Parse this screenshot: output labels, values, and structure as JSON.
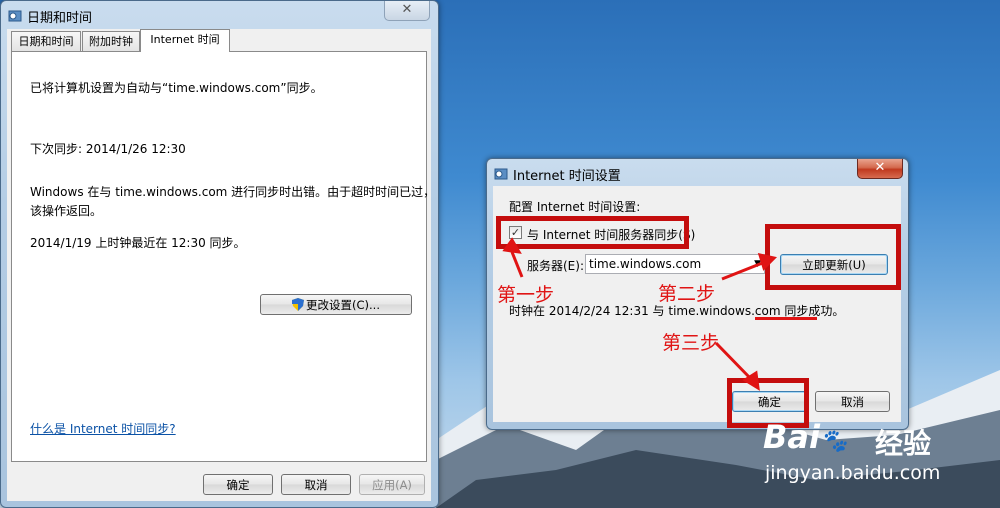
{
  "main_window": {
    "title": "日期和时间",
    "tabs": [
      {
        "label": "日期和时间"
      },
      {
        "label": "附加时钟"
      },
      {
        "label": "Internet 时间"
      }
    ],
    "status_line": "已将计算机设置为自动与“time.windows.com”同步。",
    "next_sync": "下次同步: 2014/1/26 12:30",
    "error_line1": "Windows 在与 time.windows.com 进行同步时出错。由于超时时间已过，",
    "error_line2": "该操作返回。",
    "last_sync": "2014/1/19 上时钟最近在 12:30 同步。",
    "change_settings": "更改设置(C)...",
    "help_link": "什么是 Internet 时间同步?",
    "ok": "确定",
    "cancel": "取消",
    "apply": "应用(A)"
  },
  "sub_window": {
    "title": "Internet 时间设置",
    "config_label": "配置 Internet 时间设置:",
    "sync_checkbox": {
      "label": "与 Internet 时间服务器同步(S)",
      "checked": true
    },
    "server_label": "服务器(E):",
    "server_value": "time.windows.com",
    "update_now": "立即更新(U)",
    "result_prefix": "时钟在 2014/2/24 12:31 与 time.windows.com ",
    "result_success": "同步成功。",
    "ok": "确定",
    "cancel": "取消"
  },
  "annotations": {
    "step1": "第一步",
    "step2": "第二步",
    "step3": "第三步",
    "color": "#e01414"
  },
  "watermark": {
    "logo_text": "Bai",
    "logo_text2": "百",
    "brand": "经验",
    "url": "jingyan.baidu.com"
  }
}
